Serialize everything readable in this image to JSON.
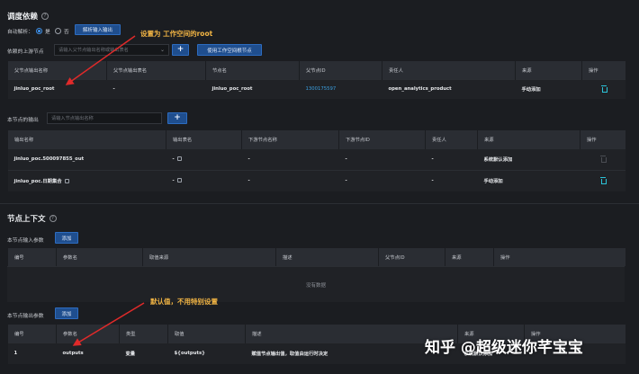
{
  "dependency": {
    "title": "调度依赖",
    "auto_parse_label": "自动解析：",
    "auto_parse_yes": "是",
    "auto_parse_no": "否",
    "parse_button": "解析输入输出",
    "upstream_label": "依赖的上游节点",
    "upstream_placeholder": "请输入父节点输出名称或输出表名",
    "use_root_button": "使用工作空间根节点",
    "columns": [
      "父节点输出名称",
      "父节点输出表名",
      "节点名",
      "父节点ID",
      "责任人",
      "来源",
      "操作"
    ],
    "rows": [
      {
        "output_name": "jinluo_poc_root",
        "table_name": "-",
        "node_name": "jinluo_poc_root",
        "node_id": "1300175597",
        "owner": "open_analytics_product",
        "source": "手动添加"
      }
    ]
  },
  "node_output": {
    "label": "本节点的输出",
    "placeholder": "请输入节点输出名称",
    "columns": [
      "输出名称",
      "输出表名",
      "下游节点名称",
      "下游节点ID",
      "责任人",
      "来源",
      "操作"
    ],
    "rows": [
      {
        "output_name": "jinluo_poc.500097855_out",
        "table_name": "-",
        "downstream_name": "-",
        "downstream_id": "-",
        "owner": "-",
        "source": "系统默认添加"
      },
      {
        "output_name": "jinluo_poc.日期集合",
        "table_name": "-",
        "downstream_name": "-",
        "downstream_id": "-",
        "owner": "-",
        "source": "手动添加"
      }
    ]
  },
  "context": {
    "title": "节点上下文",
    "input_label": "本节点输入参数",
    "add_label": "添加",
    "input_columns": [
      "编号",
      "参数名",
      "取值来源",
      "描述",
      "父节点ID",
      "来源",
      "操作"
    ],
    "input_empty": "没有数据",
    "output_label": "本节点输出参数",
    "output_columns": [
      "编号",
      "参数名",
      "类型",
      "取值",
      "描述",
      "来源",
      "操作"
    ],
    "output_rows": [
      {
        "index": "1",
        "name": "outputs",
        "type": "变量",
        "value": "${outputs}",
        "desc": "赋值节点输出值，取值由运行时决定",
        "source": "系统默认添加"
      }
    ]
  },
  "annotations": {
    "root_note": "设置为 工作空间的root",
    "default_note": "默认值，不用特别设置"
  },
  "watermark": "知乎 @超级迷你芊宝宝",
  "colors": {
    "accent": "#3d8fe8",
    "annotation": "#f2b544",
    "link": "#3a9fe0",
    "delete": "#2bc3d8"
  }
}
